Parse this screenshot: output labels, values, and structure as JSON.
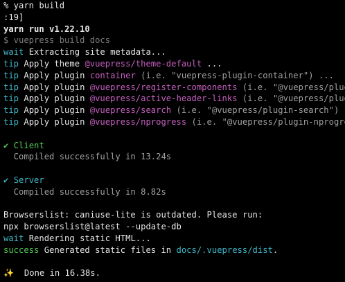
{
  "colors": {
    "background": "#000000",
    "text": "#e6e6e6",
    "cyan": "#3fb8c8",
    "magenta": "#c75fc0",
    "green": "#54c954",
    "dim": "#7c7c7c",
    "gray": "#a0a0a0",
    "sparkle": "#e8c84a"
  },
  "lines": {
    "prompt": "% yarn build",
    "partial": ":19]",
    "yarn_run": "yarn run v1.22.10",
    "command": "$ vuepress build docs",
    "wait1_tag": "wait",
    "wait1_text": " Extracting site metadata...",
    "theme_tag": "tip",
    "theme_text": " Apply theme ",
    "theme_name": "@vuepress/theme-default",
    "theme_rest": " ...",
    "p1_tag": "tip",
    "p1_text": " Apply plugin ",
    "p1_name": "container",
    "p1_rest": " (i.e. \"vuepress-plugin-container\") ...",
    "p2_tag": "tip",
    "p2_text": " Apply plugin ",
    "p2_name": "@vuepress/register-components",
    "p2_rest": " (i.e. \"@vuepress/plugi",
    "p3_tag": "tip",
    "p3_text": " Apply plugin ",
    "p3_name": "@vuepress/active-header-links",
    "p3_rest": " (i.e. \"@vuepress/plugi",
    "p4_tag": "tip",
    "p4_text": " Apply plugin ",
    "p4_name": "@vuepress/search",
    "p4_rest": " (i.e. \"@vuepress/plugin-search\") ..",
    "p5_tag": "tip",
    "p5_text": " Apply plugin ",
    "p5_name": "@vuepress/nprogress",
    "p5_rest": " (i.e. \"@vuepress/plugin-nprogres",
    "client_check": "✔",
    "client_label": " Client",
    "client_compiled": "  Compiled successfully in 13.24s",
    "server_check": "✔",
    "server_label": " Server",
    "server_compiled": "  Compiled successfully in 8.82s",
    "browserslist": "Browserslist: caniuse-lite is outdated. Please run:",
    "npx": "npx browserslist@latest --update-db",
    "wait2_tag": "wait",
    "wait2_text": " Rendering static HTML...",
    "success_tag": "success",
    "success_text": " Generated static files in ",
    "success_path": "docs/.vuepress/dist",
    "success_end": ".",
    "sparkle": "✨",
    "done": "  Done in 16.38s."
  }
}
